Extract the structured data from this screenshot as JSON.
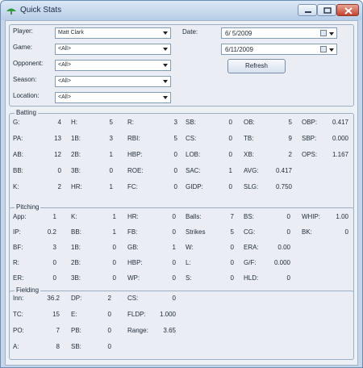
{
  "window": {
    "title": "Quick Stats"
  },
  "filters": {
    "player": {
      "label": "Player:",
      "value": "Matt Clark"
    },
    "game": {
      "label": "Game:",
      "value": "<All>"
    },
    "opponent": {
      "label": "Opponent:",
      "value": "<All>"
    },
    "season": {
      "label": "Season:",
      "value": "<All>"
    },
    "location": {
      "label": "Location:",
      "value": "<All>"
    },
    "date_label": "Date:",
    "date_from": "6/  5/2009",
    "date_to": "6/11/2009",
    "refresh_label": "Refresh"
  },
  "batting": {
    "title": "Batting",
    "stats": [
      [
        "G:",
        "4"
      ],
      [
        "H:",
        "5"
      ],
      [
        "R:",
        "3"
      ],
      [
        "SB:",
        "0"
      ],
      [
        "OB:",
        "5"
      ],
      [
        "OBP:",
        "0.417"
      ],
      [
        "PA:",
        "13"
      ],
      [
        "1B:",
        "3"
      ],
      [
        "RBI:",
        "5"
      ],
      [
        "CS:",
        "0"
      ],
      [
        "TB:",
        "9"
      ],
      [
        "SBP:",
        "0.000"
      ],
      [
        "AB:",
        "12"
      ],
      [
        "2B:",
        "1"
      ],
      [
        "HBP:",
        "0"
      ],
      [
        "LOB:",
        "0"
      ],
      [
        "XB:",
        "2"
      ],
      [
        "OPS:",
        "1.167"
      ],
      [
        "BB:",
        "0"
      ],
      [
        "3B:",
        "0"
      ],
      [
        "ROE:",
        "0"
      ],
      [
        "SAC:",
        "1"
      ],
      [
        "AVG:",
        "0.417"
      ],
      [
        "K:",
        "2"
      ],
      [
        "HR:",
        "1"
      ],
      [
        "FC:",
        "0"
      ],
      [
        "GIDP:",
        "0"
      ],
      [
        "SLG:",
        "0.750"
      ]
    ]
  },
  "pitching": {
    "title": "Pitching",
    "stats": [
      [
        "App:",
        "1"
      ],
      [
        "K:",
        "1"
      ],
      [
        "HR:",
        "0"
      ],
      [
        "Balls:",
        "7"
      ],
      [
        "BS:",
        "0"
      ],
      [
        "WHIP:",
        "1.00"
      ],
      [
        "IP:",
        "0.2"
      ],
      [
        "BB:",
        "1"
      ],
      [
        "FB:",
        "0"
      ],
      [
        "Strikes",
        "5"
      ],
      [
        "CG:",
        "0"
      ],
      [
        "BK:",
        "0"
      ],
      [
        "BF:",
        "3"
      ],
      [
        "1B:",
        "0"
      ],
      [
        "GB:",
        "1"
      ],
      [
        "W:",
        "0"
      ],
      [
        "ERA:",
        "0.00"
      ],
      [
        "R:",
        "0"
      ],
      [
        "2B:",
        "0"
      ],
      [
        "HBP:",
        "0"
      ],
      [
        "L:",
        "0"
      ],
      [
        "G/F:",
        "0.000"
      ],
      [
        "ER:",
        "0"
      ],
      [
        "3B:",
        "0"
      ],
      [
        "WP:",
        "0"
      ],
      [
        "S:",
        "0"
      ],
      [
        "HLD:",
        "0"
      ]
    ]
  },
  "fielding": {
    "title": "Fielding",
    "stats": [
      [
        "Inn:",
        "36.2"
      ],
      [
        "DP:",
        "2"
      ],
      [
        "CS:",
        "0"
      ],
      [
        "TC:",
        "15"
      ],
      [
        "E:",
        "0"
      ],
      [
        "FLDP:",
        "1.000"
      ],
      [
        "PO:",
        "7"
      ],
      [
        "PB:",
        "0"
      ],
      [
        "Range:",
        "3.65"
      ],
      [
        "A:",
        "8"
      ],
      [
        "SB:",
        "0"
      ]
    ]
  }
}
